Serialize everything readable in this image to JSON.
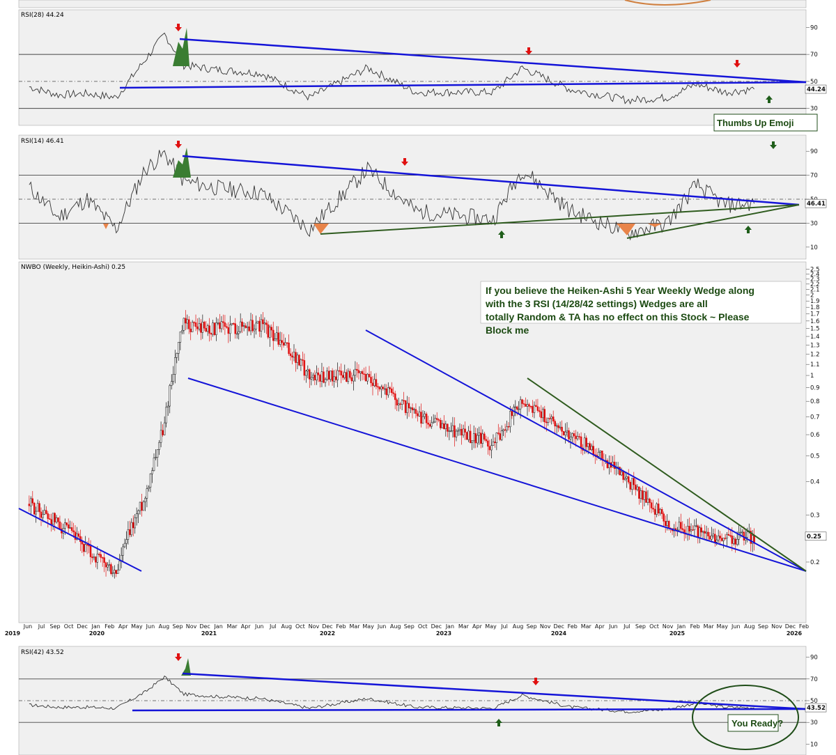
{
  "chart_data": [
    {
      "type": "line",
      "title": "RSI(28) 44.24",
      "ylim": [
        20,
        100
      ],
      "y_ticks": [
        30,
        50,
        70,
        90
      ],
      "reference_lines": [
        30,
        50,
        70
      ],
      "last_value_label": "44.24",
      "x": [
        "2019-06",
        "2019-09",
        "2019-12",
        "2020-03",
        "2020-06",
        "2020-08",
        "2020-10",
        "2021-01",
        "2021-06",
        "2021-11",
        "2022-05",
        "2022-10",
        "2023-06",
        "2023-09",
        "2024-02",
        "2024-08",
        "2024-12",
        "2025-03",
        "2025-06",
        "2025-09"
      ],
      "values": [
        46,
        40,
        41,
        38,
        66,
        85,
        62,
        59,
        56,
        38,
        60,
        42,
        42,
        60,
        44,
        36,
        38,
        48,
        42,
        44.24
      ],
      "color": "#333333"
    },
    {
      "type": "line",
      "title": "RSI(14) 46.41",
      "ylim": [
        0,
        100
      ],
      "y_ticks": [
        10,
        30,
        50,
        70,
        90
      ],
      "reference_lines": [
        30,
        50,
        70
      ],
      "last_value_label": "46.41",
      "x": [
        "2019-06",
        "2019-09",
        "2019-12",
        "2020-03",
        "2020-06",
        "2020-08",
        "2020-10",
        "2021-01",
        "2021-06",
        "2021-11",
        "2022-05",
        "2022-10",
        "2023-06",
        "2023-09",
        "2024-02",
        "2024-08",
        "2024-12",
        "2025-03",
        "2025-06",
        "2025-09"
      ],
      "values": [
        60,
        35,
        50,
        25,
        75,
        88,
        65,
        60,
        55,
        25,
        75,
        40,
        33,
        75,
        40,
        22,
        30,
        62,
        45,
        46.41
      ],
      "color": "#333333"
    },
    {
      "type": "line",
      "title": "NWBO (Weekly, Heikin-Ashi) 0.25",
      "log_scale": true,
      "ylim": [
        0.12,
        2.6
      ],
      "y_ticks": [
        0.2,
        0.25,
        0.3,
        0.4,
        0.5,
        0.6,
        0.7,
        0.8,
        0.9,
        1.0,
        1.1,
        1.2,
        1.3,
        1.4,
        1.5,
        1.6,
        1.7,
        1.8,
        1.9,
        2.0,
        2.1,
        2.2,
        2.3,
        2.4,
        2.5
      ],
      "last_value_label": "0.25",
      "x": [
        "2019-06",
        "2019-09",
        "2019-12",
        "2020-03",
        "2020-06",
        "2020-08",
        "2020-10",
        "2021-01",
        "2021-06",
        "2021-11",
        "2022-05",
        "2022-10",
        "2023-06",
        "2023-09",
        "2024-02",
        "2024-08",
        "2024-12",
        "2025-03",
        "2025-06",
        "2025-09"
      ],
      "values": [
        0.33,
        0.28,
        0.22,
        0.18,
        0.35,
        0.65,
        1.55,
        1.5,
        1.55,
        1.0,
        1.0,
        0.7,
        0.55,
        0.8,
        0.6,
        0.4,
        0.28,
        0.26,
        0.24,
        0.25
      ],
      "annotation": "If you believe the Heiken-Ashi 5 Year Weekly Wedge along with the 3 RSI (14/28/42 settings) Wedges are all totally Random & TA has no effect on this Stock ~ Please Block me"
    },
    {
      "type": "line",
      "title": "RSI(42) 43.52",
      "ylim": [
        0,
        100
      ],
      "y_ticks": [
        10,
        30,
        50,
        70,
        90
      ],
      "reference_lines": [
        30,
        50,
        70
      ],
      "last_value_label": "43.52",
      "x": [
        "2019-06",
        "2019-09",
        "2019-12",
        "2020-03",
        "2020-06",
        "2020-08",
        "2020-10",
        "2021-01",
        "2021-06",
        "2021-11",
        "2022-05",
        "2022-10",
        "2023-06",
        "2023-09",
        "2024-02",
        "2024-08",
        "2024-12",
        "2025-03",
        "2025-06",
        "2025-09"
      ],
      "values": [
        46,
        44,
        44,
        43,
        58,
        72,
        56,
        54,
        52,
        43,
        52,
        44,
        43,
        55,
        44,
        40,
        42,
        48,
        44,
        43.52
      ],
      "color": "#333333",
      "annotation": "You Ready?"
    }
  ],
  "x_axis": {
    "months": [
      "Jun",
      "Jul",
      "Sep",
      "Oct",
      "Dec",
      "Jan",
      "Feb",
      "Apr",
      "May",
      "Jun",
      "Aug",
      "Sep",
      "Nov",
      "Dec",
      "Jan",
      "Mar",
      "Apr",
      "Jun",
      "Jul",
      "Aug",
      "Oct",
      "Nov",
      "Dec",
      "Feb",
      "Mar",
      "May",
      "Jun",
      "Aug",
      "Sep",
      "Oct",
      "Dec",
      "Jan",
      "Mar",
      "Apr",
      "May",
      "Jul",
      "Aug",
      "Sep",
      "Nov",
      "Dec",
      "Feb",
      "Mar",
      "Apr",
      "Jun",
      "Jul",
      "Sep",
      "Oct",
      "Nov",
      "Jan",
      "Feb",
      "Mar",
      "May",
      "Jun",
      "Aug",
      "Sep",
      "Nov",
      "Dec",
      "Feb"
    ],
    "years": [
      "2019",
      "2020",
      "2021",
      "2022",
      "2023",
      "2024",
      "2025",
      "2026"
    ]
  },
  "callouts": {
    "thumbs": "Thumbs Up Emoji",
    "ready": "You Ready?"
  },
  "colors": {
    "trendline_blue": "#1414d8",
    "trendline_green": "#2e5b1e",
    "candle_up": "#111111",
    "candle_down": "#e01010",
    "overbought_fill": "#3a7d32",
    "oversold_fill": "#e8844a",
    "arrow_red": "#e01010",
    "arrow_green": "#1f5e1a"
  }
}
